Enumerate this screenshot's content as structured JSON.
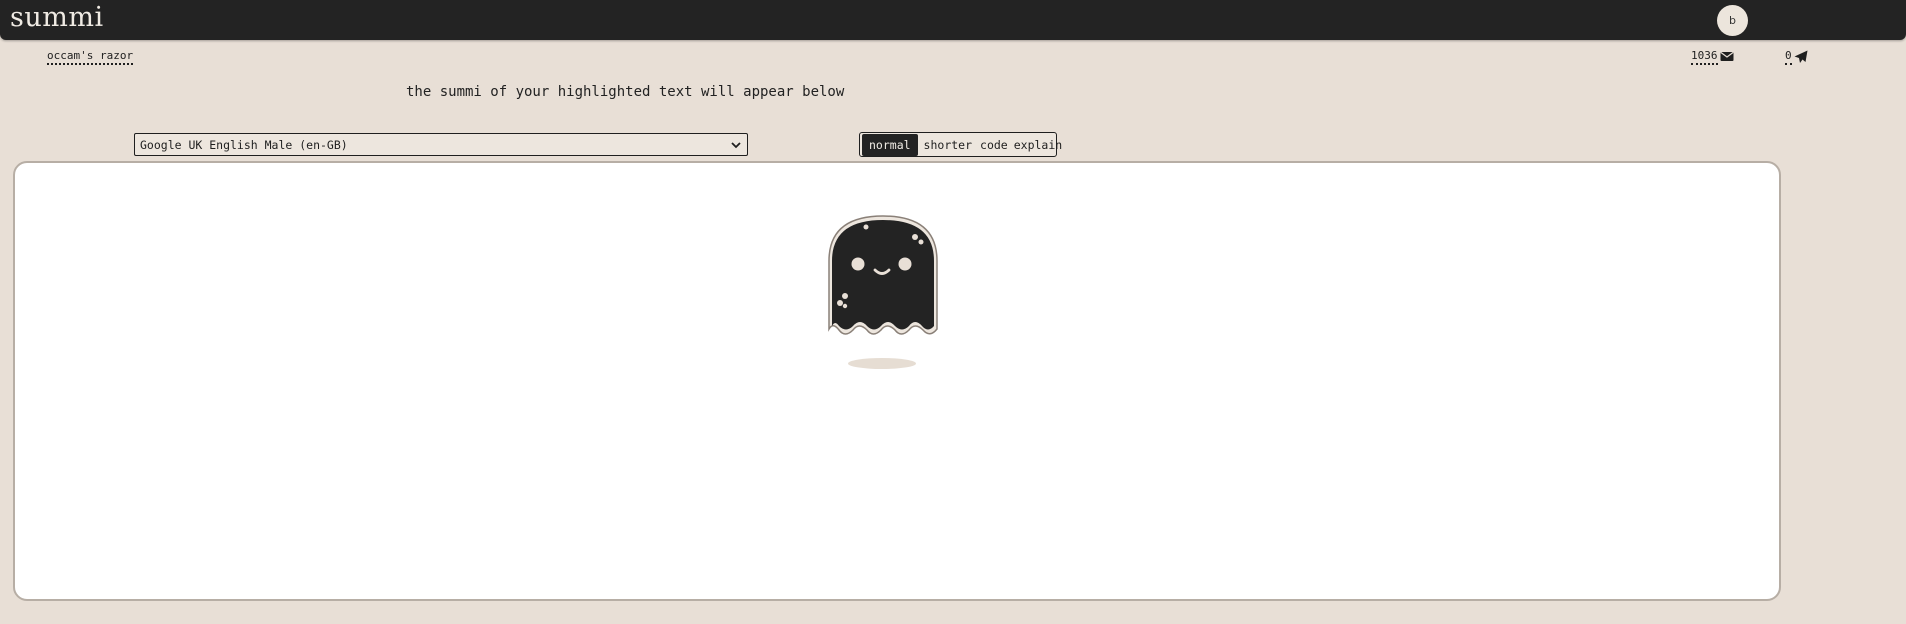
{
  "header": {
    "brand": "summi",
    "avatar_letter": "b"
  },
  "subnav": {
    "occam_link": "occam's razor"
  },
  "counters": {
    "mail_count": "1036",
    "send_count": "0"
  },
  "main": {
    "headline": "the summi of your highlighted text will appear below",
    "voice_select": {
      "selected": "Google UK English Male (en-GB)"
    },
    "modes": [
      {
        "label": "normal",
        "active": true
      },
      {
        "label": "shorter",
        "active": false
      },
      {
        "label": "code",
        "active": false
      },
      {
        "label": "explain",
        "active": false
      }
    ]
  },
  "colors": {
    "background": "#e8dfd6",
    "topbar": "#232323",
    "panel": "#ffffff",
    "ghost": "#232323"
  },
  "icons": {
    "mail": "envelope-icon",
    "send": "paper-plane-icon",
    "dropdown": "chevron-down-icon",
    "mascot": "ghost-icon"
  }
}
